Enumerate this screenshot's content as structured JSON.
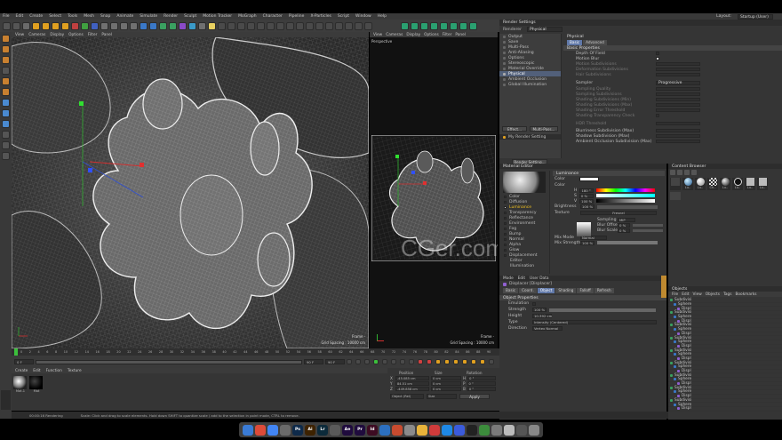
{
  "app": {
    "menus": [
      "File",
      "Edit",
      "Create",
      "Select",
      "Tools",
      "Mesh",
      "Snap",
      "Animate",
      "Simulate",
      "Render",
      "Sculpt",
      "Motion Tracker",
      "MoGraph",
      "Character",
      "Pipeline",
      "X-Particles",
      "Script",
      "Window",
      "Help"
    ],
    "layout_label": "Layout:",
    "layout_value": "Startup (User)"
  },
  "viewport_main": {
    "menus": [
      "View",
      "Cameras",
      "Display",
      "Options",
      "Filter",
      "Panel"
    ],
    "frame": "Frame ·",
    "grid_spacing": "Grid Spacing : 10000 cm"
  },
  "viewport_persp": {
    "title": "Perspective",
    "menus": [
      "View",
      "Cameras",
      "Display",
      "Options",
      "Filter",
      "Panel"
    ],
    "frame": "Frame ·",
    "grid_spacing": "Grid Spacing : 10000 cm",
    "watermark": "CGer.com"
  },
  "render_settings": {
    "title": "Render Settings",
    "renderer_label": "Renderer",
    "renderer_value": "Physical",
    "items": [
      "Output",
      "Save",
      "Multi-Pass",
      "Anti-Aliasing",
      "Options",
      "Stereoscopic",
      "Material Override",
      "Physical",
      "Ambient Occlusion",
      "Global Illumination"
    ],
    "effect_button": "Effect...",
    "multipass_button": "Multi-Pass...",
    "my_setting": "My Render Setting",
    "render_setting_button": "Render Setting..."
  },
  "physical": {
    "title": "Physical",
    "tab_basic": "Basic",
    "tab_advanced": "Advanced",
    "section_basic": "Basic Properties",
    "rows": [
      {
        "label": "Depth Of Field",
        "value": ""
      },
      {
        "label": "Motion Blur",
        "value": ""
      },
      {
        "label": "Motion Subdivisions",
        "value": ""
      },
      {
        "label": "Deformation Subdivisions",
        "value": ""
      },
      {
        "label": "Hair Subdivisions",
        "value": ""
      }
    ],
    "sampler_label": "Sampler",
    "sampler_value": "Progressive",
    "sampler_rows": [
      "Sampling Quality",
      "Sampling Subdivisions",
      "Shading Subdivisions (Min)",
      "Shading Subdivisions (Max)",
      "Shading Error Threshold",
      "Shading Transparency Check",
      "HDR Threshold"
    ],
    "blurriness": "Blurriness Subdivision (Max)",
    "shadow": "Shadow Subdivision (Max)",
    "ao": "Ambient Occlusion Subdivision (Max)"
  },
  "material_editor": {
    "title": "Material Editor",
    "channels": [
      "Color",
      "Diffusion",
      "Luminance",
      "Transparency",
      "Reflectance",
      "Environment",
      "Fog",
      "Bump",
      "Normal",
      "Alpha",
      "Glow",
      "Displacement",
      "Editor",
      "Illumination"
    ],
    "section": "Luminance",
    "color_label": "Color",
    "color_label2": "Color",
    "h": "H",
    "h_val": "180 °",
    "s": "S",
    "s_val": "0 %",
    "v": "V",
    "v_val": "100 %",
    "brightness": "Brightness",
    "brightness_val": "100 %",
    "texture": "Texture",
    "texture_value": "Fresnel",
    "sampling": "Sampling",
    "sampling_val": "MIP",
    "blur_offset": "Blur Offset",
    "blur_offset_val": "0 %",
    "blur_scale": "Blur Scale",
    "blur_scale_val": "0 %",
    "mix_mode": "Mix Mode",
    "mix_mode_val": "Normal",
    "mix_strength": "Mix Strength",
    "mix_strength_val": "100 %"
  },
  "content_browser": {
    "title": "Content Browser",
    "items": [
      "",
      "Lu..",
      "Lu..",
      "Ch..",
      "Lu..",
      "Lu..",
      "Lu..",
      "Lu.."
    ]
  },
  "attributes": {
    "menus": [
      "Mode",
      "Edit",
      "User Data"
    ],
    "object_label": "Displacer [Displacer]",
    "tabs": [
      "Basic",
      "Coord.",
      "Object",
      "Shading",
      "Falloff",
      "Refresh"
    ],
    "section": "Object Properties",
    "emulation": "Emulation",
    "strength": "Strength",
    "strength_val": "100 %",
    "height": "Height",
    "height_val": "10.392 cm",
    "type": "Type",
    "type_val": "Intensity (Centered)",
    "direction": "Direction",
    "direction_val": "Vertex Normal"
  },
  "objects": {
    "title": "Objects",
    "menus": [
      "File",
      "Edit",
      "View",
      "Objects",
      "Tags",
      "Bookmarks"
    ],
    "rows": [
      "Subdivisi",
      "Sphere",
      "Displ",
      "Subdivisi",
      "Sphere",
      "Displ",
      "Subdivisi",
      "Sphere",
      "Displ",
      "Subdivisi",
      "Sphere",
      "Displ",
      "Subdivisi",
      "Sphere",
      "Displ",
      "Subdivisi",
      "Sphere",
      "Displ",
      "Subdivisi",
      "Sphere",
      "Displ",
      "Subdivisi",
      "Sphere",
      "Displ",
      "Subdivisi",
      "Sphere",
      "Displ"
    ]
  },
  "timeline": {
    "start_frame": "0 F",
    "end_frame": "90 F",
    "end_frame2": "90 F",
    "current": "0 F",
    "ticks": [
      "0",
      "2",
      "4",
      "6",
      "8",
      "10",
      "12",
      "14",
      "16",
      "18",
      "20",
      "22",
      "24",
      "26",
      "28",
      "30",
      "32",
      "34",
      "36",
      "38",
      "40",
      "42",
      "44",
      "46",
      "48",
      "50",
      "52",
      "54",
      "56",
      "58",
      "60",
      "62",
      "64",
      "66",
      "68",
      "70",
      "72",
      "74",
      "76",
      "78",
      "80",
      "82",
      "84",
      "86",
      "88",
      "90"
    ]
  },
  "materials": {
    "menus": [
      "Create",
      "Edit",
      "Function",
      "Texture"
    ],
    "items": [
      "Mat.1",
      "Mat"
    ]
  },
  "coords": {
    "position_label": "Position",
    "size_label": "Size",
    "rotation_label": "Rotation",
    "rows": [
      {
        "axis": "X",
        "pos": "-45.085 cm",
        "size": "0 cm",
        "rot_axis": "H",
        "rot": "0 °"
      },
      {
        "axis": "Y",
        "pos": "84.51 cm",
        "size": "0 cm",
        "rot_axis": "P",
        "rot": "0 °"
      },
      {
        "axis": "Z",
        "pos": "-449.858 cm",
        "size": "0 cm",
        "rot_axis": "B",
        "rot": "0 °"
      }
    ],
    "mode": "Object (Rel)",
    "size_mode": "Size",
    "apply": "Apply"
  },
  "status": {
    "time": "00:00:16 Rendering",
    "message": "Scale: Click and drag to scale elements. Hold down SHIFT to quantize scale / add to the selection in point mode, CTRL to remove."
  },
  "dock": [
    {
      "label": "",
      "color": "#3a7bd5"
    },
    {
      "label": "",
      "color": "#dd4b39"
    },
    {
      "label": "",
      "color": "#4285f4"
    },
    {
      "label": "",
      "color": "#6a6a6a"
    },
    {
      "label": "Ps",
      "color": "#0e2a4a"
    },
    {
      "label": "Ai",
      "color": "#3d2200"
    },
    {
      "label": "Lr",
      "color": "#0c2a3a"
    },
    {
      "label": "",
      "color": "#5a5a5a"
    },
    {
      "label": "Ae",
      "color": "#1f0b3d"
    },
    {
      "label": "Pr",
      "color": "#1f0b3d"
    },
    {
      "label": "Id",
      "color": "#3d0b22"
    },
    {
      "label": "",
      "color": "#2c6fbf"
    },
    {
      "label": "",
      "color": "#c84b2f"
    },
    {
      "label": "",
      "color": "#8a8a8a"
    },
    {
      "label": "",
      "color": "#e8b33a"
    },
    {
      "label": "",
      "color": "#cf3b3b"
    },
    {
      "label": "",
      "color": "#1e88e5"
    },
    {
      "label": "",
      "color": "#3b5bdb"
    },
    {
      "label": "",
      "color": "#222222"
    },
    {
      "label": "",
      "color": "#3c8c3c"
    },
    {
      "label": "",
      "color": "#7a7a7a"
    },
    {
      "label": "",
      "color": "#bbbbbb"
    },
    {
      "label": "",
      "color": "#555555"
    },
    {
      "label": "",
      "color": "#888888"
    }
  ]
}
